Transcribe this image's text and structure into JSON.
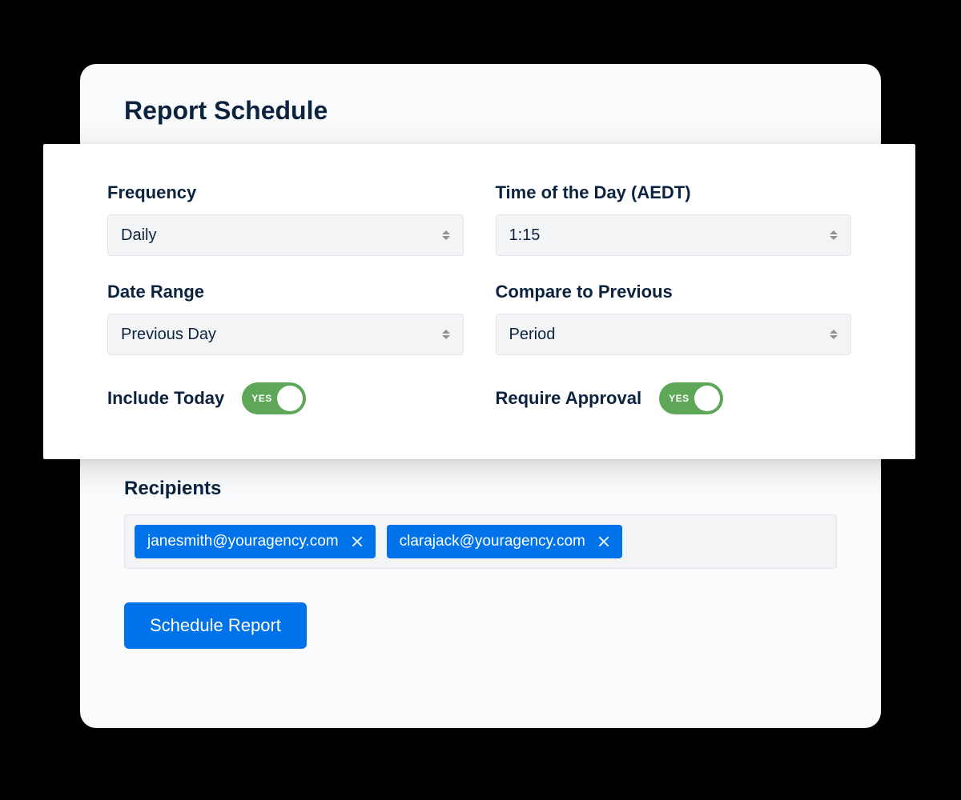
{
  "title": "Report Schedule",
  "fields": {
    "frequency": {
      "label": "Frequency",
      "value": "Daily"
    },
    "time": {
      "label": "Time of the Day (AEDT)",
      "value": "1:15"
    },
    "dateRange": {
      "label": "Date Range",
      "value": "Previous Day"
    },
    "compareTo": {
      "label": "Compare to Previous",
      "value": "Period"
    }
  },
  "toggles": {
    "includeToday": {
      "label": "Include Today",
      "state": "YES"
    },
    "requireApproval": {
      "label": "Require Approval",
      "state": "YES"
    }
  },
  "recipients": {
    "label": "Recipients",
    "items": [
      "janesmith@youragency.com",
      "clarajack@youragency.com"
    ]
  },
  "submit": {
    "label": "Schedule Report"
  }
}
